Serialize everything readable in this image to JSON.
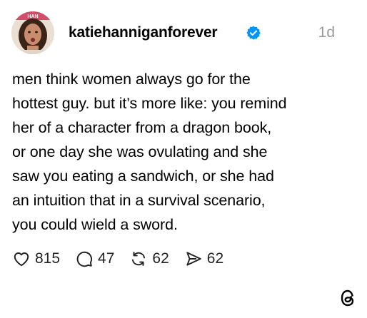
{
  "post": {
    "username": "katiehanniganforever",
    "time": "1d",
    "avatar_text": "HAN",
    "body_lines": [
      "men think women always go for the",
      "hottest guy. but it’s more like: you remind",
      "her of a character from a dragon book,",
      "or one day she was ovulating and she",
      "saw you eating a sandwich, or she had",
      "an intuition that in a survival scenario,",
      "you could wield a sword."
    ],
    "stats": {
      "likes": "815",
      "replies": "47",
      "reposts": "62",
      "shares": "62"
    }
  },
  "icons": {
    "verified": "verified-badge-icon",
    "like": "heart-icon",
    "reply": "comment-bubble-icon",
    "repost": "repost-arrows-icon",
    "share": "send-icon",
    "app": "threads-logo-icon"
  },
  "colors": {
    "verified": "#0095f6",
    "timestamp": "#9a9a9a",
    "text": "#000000"
  }
}
